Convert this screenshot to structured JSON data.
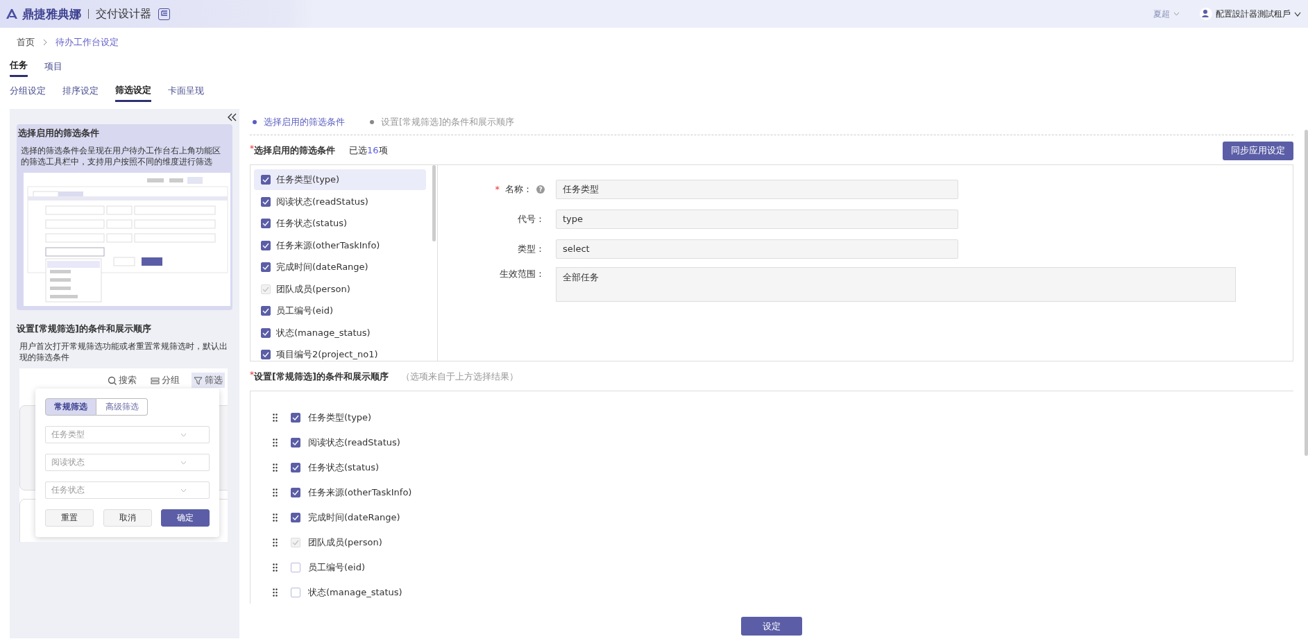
{
  "header": {
    "logo": "鼎捷雅典娜",
    "app_title": "交付设计器",
    "user": "夏超",
    "tenant": "配置設計器測試租戶"
  },
  "breadcrumb": [
    {
      "label": "首页",
      "current": false
    },
    {
      "label": "待办工作台设定",
      "current": true
    }
  ],
  "tabs": [
    {
      "label": "任务",
      "selected": true
    },
    {
      "label": "项目",
      "selected": false
    }
  ],
  "sub_tabs": [
    {
      "label": "分组设定",
      "selected": false
    },
    {
      "label": "排序设定",
      "selected": false
    },
    {
      "label": "筛选设定",
      "selected": true
    },
    {
      "label": "卡面呈现",
      "selected": false
    }
  ],
  "guide_panel": {
    "sections": [
      {
        "title": "选择启用的筛选条件",
        "description": "选择的筛选条件会呈现在用户待办工作台右上角功能区的筛选工具栏中，支持用户按照不同的维度进行筛选",
        "selected": true,
        "kind": "picture"
      },
      {
        "title": "设置[常规筛选]的条件和展示顺序",
        "description": "用户首次打开常规筛选功能或者重置常规筛选时，默认出现的筛选条件",
        "selected": false,
        "kind": "preview",
        "preview": {
          "toolbar": [
            {
              "label": "搜索",
              "kind": "search",
              "selected": false
            },
            {
              "label": "分组",
              "kind": "group",
              "selected": false
            },
            {
              "label": "筛选",
              "kind": "filter",
              "selected": true
            }
          ],
          "filter_tabs": [
            {
              "label": "常规筛选",
              "selected": true
            },
            {
              "label": "高级筛选",
              "selected": false
            }
          ],
          "selects": [
            {
              "placeholder": "任务类型"
            },
            {
              "placeholder": "阅读状态"
            },
            {
              "placeholder": "任务状态"
            }
          ],
          "buttons": [
            {
              "label": "重置",
              "primary": false
            },
            {
              "label": "取消",
              "primary": false
            },
            {
              "label": "确定",
              "primary": true
            }
          ]
        }
      }
    ]
  },
  "steps": [
    {
      "label": "选择启用的筛选条件",
      "active": true
    },
    {
      "label": "设置[常规筛选]的条件和展示顺序",
      "active": false
    }
  ],
  "section1": {
    "title": "选择启用的筛选条件",
    "required_mark": "*",
    "count_prefix": "已选",
    "count": "16",
    "count_suffix": "项",
    "sync_button": "同步应用设定",
    "items": [
      {
        "label": "任务类型(type)",
        "checked": true,
        "disabled": false,
        "selected": true
      },
      {
        "label": "阅读状态(readStatus)",
        "checked": true,
        "disabled": false,
        "selected": false
      },
      {
        "label": "任务状态(status)",
        "checked": true,
        "disabled": false,
        "selected": false
      },
      {
        "label": "任务来源(otherTaskInfo)",
        "checked": true,
        "disabled": false,
        "selected": false
      },
      {
        "label": "完成时间(dateRange)",
        "checked": true,
        "disabled": false,
        "selected": false
      },
      {
        "label": "团队成员(person)",
        "checked": true,
        "disabled": true,
        "selected": false
      },
      {
        "label": "员工编号(eid)",
        "checked": true,
        "disabled": false,
        "selected": false
      },
      {
        "label": "状态(manage_status)",
        "checked": true,
        "disabled": false,
        "selected": false
      },
      {
        "label": "项目编号2(project_no1)",
        "checked": true,
        "disabled": false,
        "selected": false
      }
    ],
    "form": [
      {
        "label": "名称：",
        "required_mark": "*",
        "help": "?",
        "value": "任务类型",
        "kind": "input"
      },
      {
        "label": "代号：",
        "value": "type",
        "kind": "input"
      },
      {
        "label": "类型：",
        "value": "select",
        "kind": "input"
      },
      {
        "label": "生效范围：",
        "value": "全部任务",
        "kind": "textarea"
      }
    ]
  },
  "section2": {
    "title": "设置[常规筛选]的条件和展示顺序",
    "required_mark": "*",
    "hint": "（选项来自于上方选择结果）",
    "items": [
      {
        "label": "任务类型(type)",
        "checked": true,
        "disabled": false
      },
      {
        "label": "阅读状态(readStatus)",
        "checked": true,
        "disabled": false
      },
      {
        "label": "任务状态(status)",
        "checked": true,
        "disabled": false
      },
      {
        "label": "任务来源(otherTaskInfo)",
        "checked": true,
        "disabled": false
      },
      {
        "label": "完成时间(dateRange)",
        "checked": true,
        "disabled": false
      },
      {
        "label": "团队成员(person)",
        "checked": true,
        "disabled": true
      },
      {
        "label": "员工编号(eid)",
        "checked": false,
        "disabled": false
      },
      {
        "label": "状态(manage_status)",
        "checked": false,
        "disabled": false
      }
    ]
  },
  "submit_button": "设定"
}
